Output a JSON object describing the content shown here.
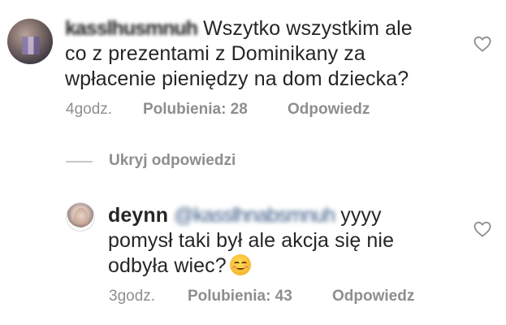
{
  "comment": {
    "username": "kasslhusmnuh",
    "text_line1": "Wszytko wszystkim ale",
    "text_line2": "co z prezentami z Dominikany za",
    "text_line3": "wpłacenie pieniędzy na dom dziecka?",
    "time": "4godz.",
    "likes": "Polubienia: 28",
    "reply": "Odpowiedz",
    "like_icon": "heart-outline-icon"
  },
  "hide_replies": "Ukryj odpowiedzi",
  "reply_comment": {
    "username": "deynn",
    "mention": "@kasslhnabsmnuh",
    "text_line1_rest": "yyyy",
    "text_line2": "pomysł taki był ale akcja się nie",
    "text_line3": "odbyła wiec?",
    "emoji": "smiling-face-emoji",
    "time": "3godz.",
    "likes": "Polubienia: 43",
    "reply": "Odpowiedz",
    "like_icon": "heart-outline-icon"
  },
  "colors": {
    "text": "#262626",
    "meta": "#8e8e8e",
    "mention": "#3b5a86",
    "background": "#ffffff"
  }
}
